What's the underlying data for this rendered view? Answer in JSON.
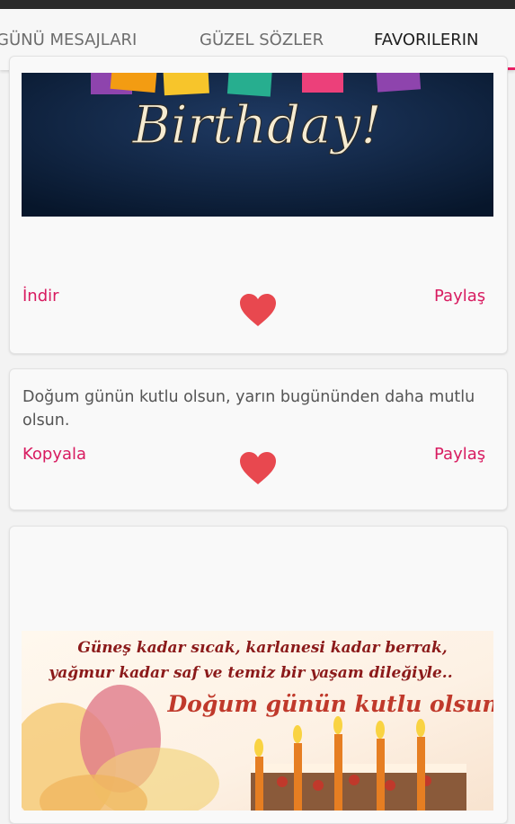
{
  "tabs": [
    {
      "label": "GÜNÜ MESAJLARI"
    },
    {
      "label": "GÜZEL SÖZLER"
    },
    {
      "label": "FAVORILERIN"
    }
  ],
  "cards": {
    "image_card_1": {
      "image_text": "Birthday!",
      "download_label": "İndir",
      "share_label": "Paylaş"
    },
    "text_card": {
      "message": "Doğum günün kutlu olsun, yarın bugününden daha mutlu olsun.",
      "copy_label": "Kopyala",
      "share_label": "Paylaş"
    },
    "image_card_2": {
      "line1": "Güneş kadar sıcak, karlanesi kadar berrak,",
      "line2": "yağmur kadar saf ve temiz bir yaşam dileğiyle..",
      "line3": "Doğum günün kutlu olsun!"
    }
  },
  "colors": {
    "accent": "#d81b60",
    "heart": "#e8484f",
    "tab_indicator": "#e91e63"
  }
}
